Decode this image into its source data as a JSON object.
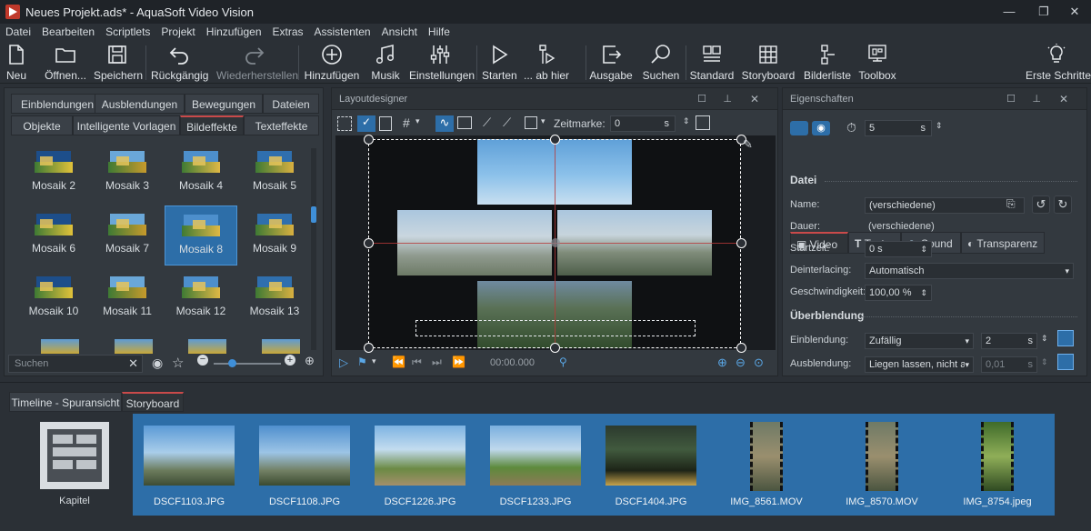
{
  "window": {
    "title": "Neues Projekt.ads* - AquaSoft Video Vision",
    "controls": [
      "—",
      "❐",
      "✕"
    ]
  },
  "menu": [
    "Datei",
    "Bearbeiten",
    "Scriptlets",
    "Projekt",
    "Hinzufügen",
    "Extras",
    "Assistenten",
    "Ansicht",
    "Hilfe"
  ],
  "toolbar": {
    "neu": "Neu",
    "oeffnen": "Öffnen...",
    "speichern": "Speichern",
    "rueckgaengig": "Rückgängig",
    "wiederherstellen": "Wiederherstellen",
    "hinzufuegen": "Hinzufügen",
    "musik": "Musik",
    "einstellungen": "Einstellungen",
    "starten": "Starten",
    "abhier": "... ab hier",
    "ausgabe": "Ausgabe",
    "suchen": "Suchen",
    "standard": "Standard",
    "storyboard": "Storyboard",
    "bilderliste": "Bilderliste",
    "toolbox": "Toolbox",
    "erste": "Erste Schritte"
  },
  "left_panel": {
    "tabs_row1": [
      "Einblendungen",
      "Ausblendungen",
      "Bewegungen",
      "Dateien"
    ],
    "tabs_row2": [
      "Objekte",
      "Intelligente Vorlagen",
      "Bildeffekte",
      "Texteffekte"
    ],
    "active_tab": "Bildeffekte",
    "effects": [
      "Mosaik 2",
      "Mosaik 3",
      "Mosaik 4",
      "Mosaik 5",
      "Mosaik 6",
      "Mosaik 7",
      "Mosaik 8",
      "Mosaik 9",
      "Mosaik 10",
      "Mosaik 11",
      "Mosaik 12",
      "Mosaik 13"
    ],
    "selected": "Mosaik 8",
    "search_placeholder": "Suchen"
  },
  "layout_designer": {
    "title": "Layoutdesigner",
    "zeitmarke_label": "Zeitmarke:",
    "zeitmarke_value": "0",
    "unit": "s",
    "time": "00:00.000"
  },
  "properties": {
    "title": "Eigenschaften",
    "duration_value": "5",
    "unit": "s",
    "tabs": [
      "Video",
      "Text",
      "Sound",
      "Transparenz"
    ],
    "section_datei": "Datei",
    "section_ueberblendung": "Überblendung",
    "rows": {
      "name_label": "Name:",
      "name_value": "(verschiedene)",
      "dauer_label": "Dauer:",
      "dauer_value": "(verschiedene)",
      "startzeit_label": "Startzeit:",
      "startzeit_value": "0 s",
      "deinterlacing_label": "Deinterlacing:",
      "deinterlacing_value": "Automatisch",
      "geschwindigkeit_label": "Geschwindigkeit:",
      "geschwindigkeit_value": "100,00 %",
      "einblendung_label": "Einblendung:",
      "einblendung_value": "Zufällig",
      "einblendung_num": "2",
      "ausblendung_label": "Ausblendung:",
      "ausblendung_value": "Liegen lassen, nicht a",
      "ausblendung_num": "0,01"
    }
  },
  "bottom": {
    "tabs": [
      "Timeline - Spuransicht",
      "Storyboard"
    ],
    "active_tab": "Storyboard",
    "chapter": "Kapitel",
    "items": [
      "DSCF1103.JPG",
      "DSCF1108.JPG",
      "DSCF1226.JPG",
      "DSCF1233.JPG",
      "DSCF1404.JPG",
      "IMG_8561.MOV",
      "IMG_8570.MOV",
      "IMG_8754.jpeg"
    ]
  },
  "colors": {
    "accent": "#2d6ea8",
    "tab_marker": "#c94a4a",
    "panel": "#33393f"
  }
}
